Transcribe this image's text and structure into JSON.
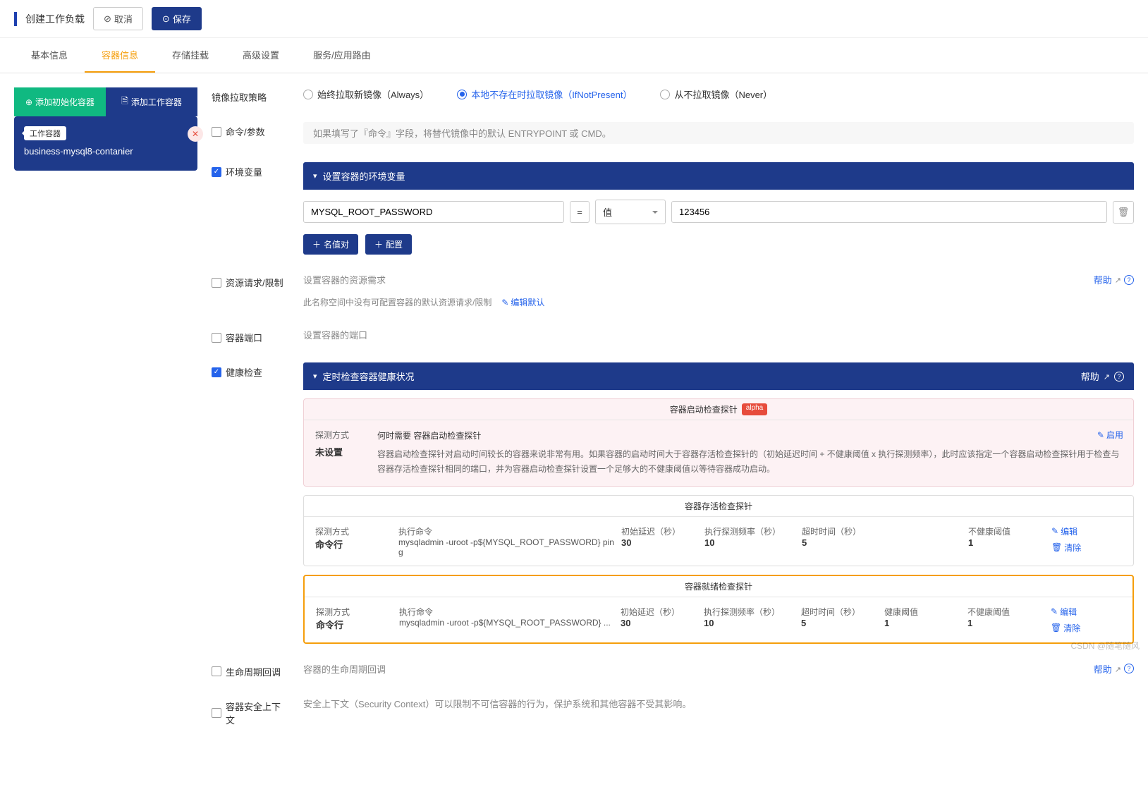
{
  "header": {
    "title": "创建工作负载",
    "cancel": "取消",
    "save": "保存"
  },
  "tabs": [
    "基本信息",
    "容器信息",
    "存储挂载",
    "高级设置",
    "服务/应用路由"
  ],
  "activeTab": 1,
  "sidebar": {
    "addInit": "添加初始化容器",
    "addWork": "添加工作容器",
    "tag": "工作容器",
    "containerName": "business-mysql8-contanier"
  },
  "imagePull": {
    "label": "镜像拉取策略",
    "opts": [
      "始终拉取新镜像（Always）",
      "本地不存在时拉取镜像（IfNotPresent）",
      "从不拉取镜像（Never）"
    ],
    "selected": 1
  },
  "cmd": {
    "label": "命令/参数",
    "hint": "如果填写了『命令』字段，将替代镜像中的默认 ENTRYPOINT 或 CMD。"
  },
  "env": {
    "label": "环境变量",
    "panelTitle": "设置容器的环境变量",
    "key": "MYSQL_ROOT_PASSWORD",
    "eq": "=",
    "typeSel": "值",
    "value": "123456",
    "addKV": "名值对",
    "addCfg": "配置"
  },
  "resource": {
    "label": "资源请求/限制",
    "hint": "设置容器的资源需求",
    "sub": "此名称空间中没有可配置容器的默认资源请求/限制",
    "editDefault": "编辑默认",
    "help": "帮助"
  },
  "port": {
    "label": "容器端口",
    "hint": "设置容器的端口"
  },
  "health": {
    "label": "健康检查",
    "panelTitle": "定时检查容器健康状况",
    "help": "帮助"
  },
  "probes": {
    "startup": {
      "title": "容器启动检查探针",
      "alpha": "alpha",
      "modeLabel": "探测方式",
      "modeVal": "未设置",
      "descTitle": "何时需要 容器启动检查探针",
      "desc": "容器启动检查探针对启动时间较长的容器来说非常有用。如果容器的启动时间大于容器存活检查探针的（初始延迟时间 + 不健康阈值 x 执行探测频率），此时应该指定一个容器启动检查探针用于检查与容器存活检查探针相同的端口，并为容器启动检查探针设置一个足够大的不健康阈值以等待容器成功启动。",
      "enable": "启用"
    },
    "liveness": {
      "title": "容器存活检查探针",
      "modeLabel": "探测方式",
      "modeVal": "命令行",
      "cmdLabel": "执行命令",
      "cmdVal": "mysqladmin -uroot -p${MYSQL_ROOT_PASSWORD} ping",
      "initLabel": "初始延迟（秒）",
      "initVal": "30",
      "freqLabel": "执行探测频率（秒）",
      "freqVal": "10",
      "timeoutLabel": "超时时间（秒）",
      "timeoutVal": "5",
      "unhealthyLabel": "不健康阈值",
      "unhealthyVal": "1",
      "edit": "编辑",
      "clear": "清除"
    },
    "readiness": {
      "title": "容器就绪检查探针",
      "modeLabel": "探测方式",
      "modeVal": "命令行",
      "cmdLabel": "执行命令",
      "cmdVal": "mysqladmin -uroot -p${MYSQL_ROOT_PASSWORD} ...",
      "initLabel": "初始延迟（秒）",
      "initVal": "30",
      "freqLabel": "执行探测频率（秒）",
      "freqVal": "10",
      "timeoutLabel": "超时时间（秒）",
      "timeoutVal": "5",
      "healthyLabel": "健康阈值",
      "healthyVal": "1",
      "unhealthyLabel": "不健康阈值",
      "unhealthyVal": "1",
      "edit": "编辑",
      "clear": "清除"
    }
  },
  "lifecycle": {
    "label": "生命周期回调",
    "hint": "容器的生命周期回调",
    "help": "帮助"
  },
  "security": {
    "label": "容器安全上下文",
    "hint": "安全上下文（Security Context）可以限制不可信容器的行为，保护系统和其他容器不受其影响。"
  },
  "watermark": "CSDN @随笔随风",
  "watermark2": "随笔随风"
}
